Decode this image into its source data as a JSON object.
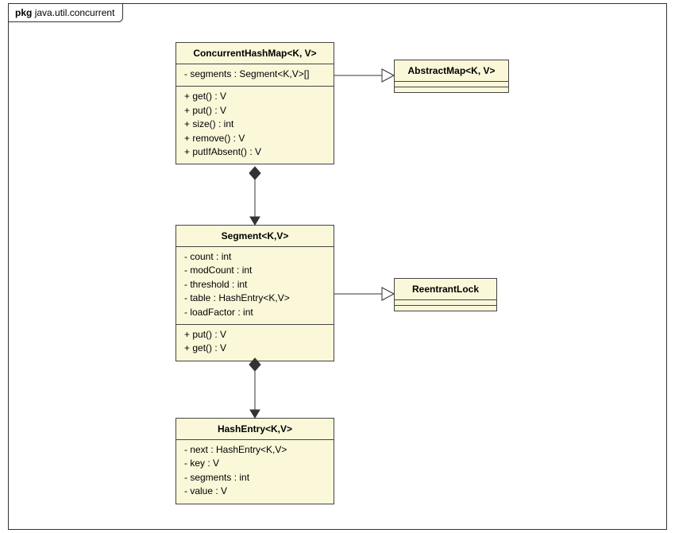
{
  "package": {
    "keyword": "pkg",
    "name": "java.util.concurrent"
  },
  "classes": {
    "concurrentHashMap": {
      "title": "ConcurrentHashMap<K, V>",
      "attributes": [
        "- segments : Segment<K,V>[]"
      ],
      "methods": [
        "+ get() : V",
        "+ put() : V",
        "+ size() : int",
        "+ remove() : V",
        "+ putIfAbsent() : V"
      ]
    },
    "abstractMap": {
      "title": "AbstractMap<K, V>"
    },
    "segment": {
      "title": "Segment<K,V>",
      "attributes": [
        "- count : int",
        "- modCount : int",
        "- threshold : int",
        "- table : HashEntry<K,V>",
        "- loadFactor : int"
      ],
      "methods": [
        "+ put() : V",
        "+ get() : V"
      ]
    },
    "reentrantLock": {
      "title": "ReentrantLock"
    },
    "hashEntry": {
      "title": "HashEntry<K,V>",
      "attributes": [
        "- next : HashEntry<K,V>",
        "- key : V",
        "- segments : int",
        "- value : V"
      ]
    }
  },
  "relations": [
    {
      "from": "ConcurrentHashMap",
      "to": "AbstractMap",
      "type": "generalization"
    },
    {
      "from": "ConcurrentHashMap",
      "to": "Segment",
      "type": "composition"
    },
    {
      "from": "Segment",
      "to": "ReentrantLock",
      "type": "generalization"
    },
    {
      "from": "Segment",
      "to": "HashEntry",
      "type": "composition"
    }
  ]
}
